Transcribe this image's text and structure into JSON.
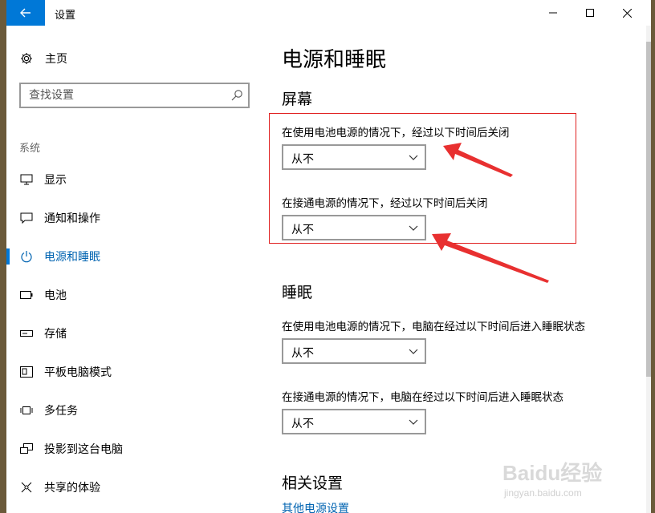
{
  "window": {
    "title": "设置",
    "back_icon": "arrow-left-icon",
    "controls": [
      "minimize-icon",
      "maximize-icon",
      "close-icon"
    ]
  },
  "sidebar": {
    "home": {
      "label": "主页",
      "icon": "gear-icon"
    },
    "search": {
      "placeholder": "查找设置",
      "icon": "search-icon"
    },
    "section_label": "系统",
    "items": [
      {
        "label": "显示",
        "icon": "monitor-icon",
        "active": false
      },
      {
        "label": "通知和操作",
        "icon": "notification-icon",
        "active": false
      },
      {
        "label": "电源和睡眠",
        "icon": "power-icon",
        "active": true
      },
      {
        "label": "电池",
        "icon": "battery-icon",
        "active": false
      },
      {
        "label": "存储",
        "icon": "storage-icon",
        "active": false
      },
      {
        "label": "平板电脑模式",
        "icon": "tablet-mode-icon",
        "active": false
      },
      {
        "label": "多任务",
        "icon": "multitasking-icon",
        "active": false
      },
      {
        "label": "投影到这台电脑",
        "icon": "project-icon",
        "active": false
      },
      {
        "label": "共享的体验",
        "icon": "shared-experience-icon",
        "active": false
      }
    ]
  },
  "main": {
    "title": "电源和睡眠",
    "screen": {
      "heading": "屏幕",
      "battery_label": "在使用电池电源的情况下，经过以下时间后关闭",
      "battery_value": "从不",
      "plugged_label": "在接通电源的情况下，经过以下时间后关闭",
      "plugged_value": "从不"
    },
    "sleep": {
      "heading": "睡眠",
      "battery_label": "在使用电池电源的情况下，电脑在经过以下时间后进入睡眠状态",
      "battery_value": "从不",
      "plugged_label": "在接通电源的情况下，电脑在经过以下时间后进入睡眠状态",
      "plugged_value": "从不"
    },
    "related": {
      "heading": "相关设置",
      "link": "其他电源设置"
    }
  },
  "annotation": {
    "color": "#e02020"
  },
  "watermark": {
    "logo": "Baidu经验",
    "url": "jingyan.baidu.com"
  },
  "colors": {
    "accent": "#0078d7",
    "link": "#0063b1"
  }
}
